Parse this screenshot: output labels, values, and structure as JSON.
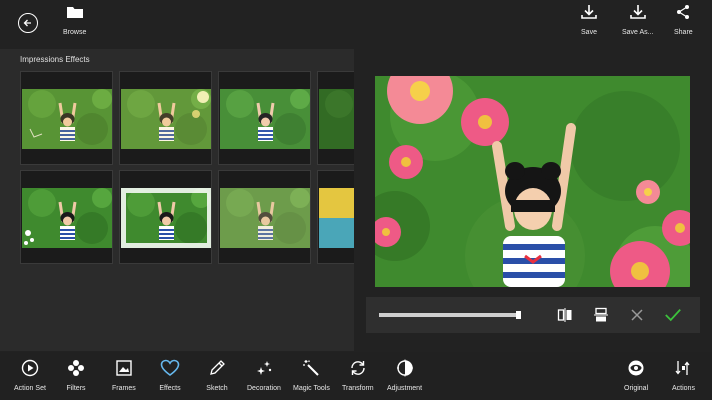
{
  "toolbar": {
    "browse_label": "Browse",
    "save_label": "Save",
    "save_as_label": "Save As...",
    "share_label": "Share"
  },
  "panel": {
    "title": "Impressions Effects"
  },
  "bottom_nav": {
    "items": [
      {
        "label": "Action Set",
        "icon": "play-circle-icon"
      },
      {
        "label": "Filters",
        "icon": "filters-icon"
      },
      {
        "label": "Frames",
        "icon": "frame-icon"
      },
      {
        "label": "Effects",
        "icon": "heart-icon"
      },
      {
        "label": "Sketch",
        "icon": "pencil-icon"
      },
      {
        "label": "Decoration",
        "icon": "sparkle-icon"
      },
      {
        "label": "Magic Tools",
        "icon": "magic-wand-icon"
      },
      {
        "label": "Transform",
        "icon": "rotate-icon"
      },
      {
        "label": "Adjustment",
        "icon": "contrast-icon"
      }
    ],
    "original_label": "Original",
    "actions_label": "Actions"
  },
  "slider": {
    "value": 0.9
  },
  "colors": {
    "background": "#222222",
    "panel": "#2b2b2b",
    "accent_green": "#3cc23c",
    "active_icon": "#66b8ee",
    "grass": "#3f8a2e"
  }
}
